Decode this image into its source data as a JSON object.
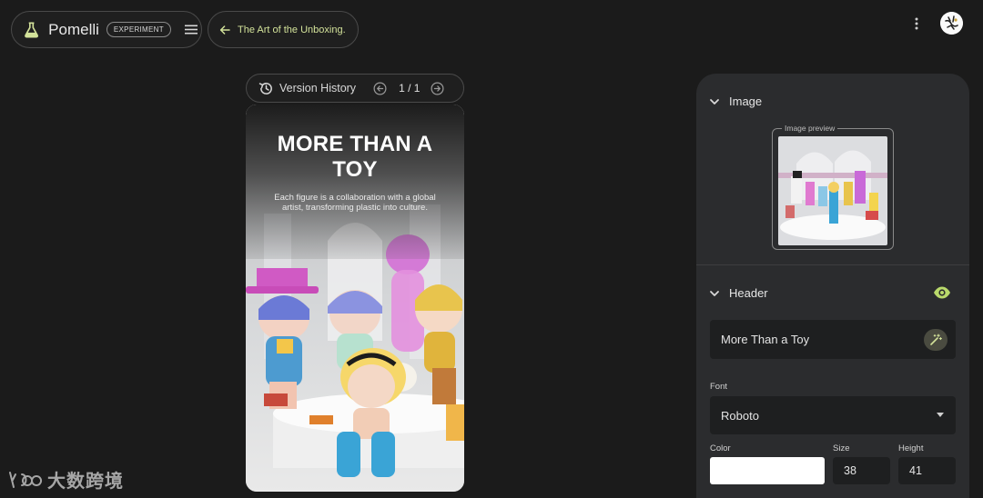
{
  "app": {
    "brand_name": "Pomelli",
    "badge": "EXPERIMENT",
    "back_label": "The Art of the Unboxing."
  },
  "version": {
    "label": "Version History",
    "page_count": "1 / 1"
  },
  "preview": {
    "title": "MORE THAN A TOY",
    "subtitle": "Each figure is a collaboration with a global artist, transforming plastic into culture."
  },
  "panel": {
    "image_section": {
      "title": "Image",
      "preview_label": "Image preview"
    },
    "header_section": {
      "title": "Header",
      "text_value": "More Than a Toy",
      "font_label": "Font",
      "font_value": "Roboto",
      "color_label": "Color",
      "color_value": "#FFFFFF",
      "size_label": "Size",
      "size_value": "38",
      "height_label": "Height",
      "height_value": "41"
    }
  },
  "watermark": {
    "text": "大数跨境"
  },
  "colors": {
    "accent_green": "#d3e29a",
    "eye_green": "#b9d96b",
    "background": "#1b1b1b",
    "panel": "#2b2c2e"
  },
  "icons": {
    "brand": "flask-icon",
    "menu": "hamburger-icon",
    "back": "arrow-left-icon",
    "history": "history-icon",
    "more": "kebab-icon",
    "visibility": "eye-icon",
    "magic": "magic-wand-icon"
  }
}
